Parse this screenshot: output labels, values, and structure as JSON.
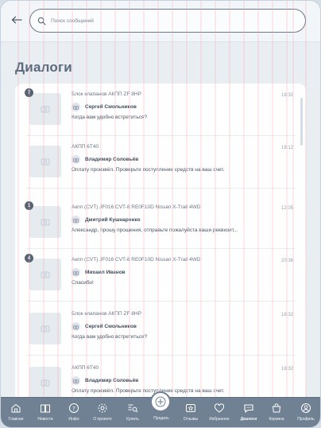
{
  "search": {
    "placeholder": "Поиск сообщений"
  },
  "page_title": "Диалоги",
  "dialogs": [
    {
      "badge": "7",
      "title": "Блок клапанов АКПП ZF 8HP",
      "user": "Сергей Смольников",
      "message": "Когда вам удобно встретиться?",
      "time": "18:32"
    },
    {
      "badge": "",
      "title": "АКПП 6T40",
      "user": "Владимир Соловьёв",
      "message": "Оплату произвёл. Проверьте поступление средств на ваш счет.",
      "time": "18:12"
    },
    {
      "badge": "1",
      "title": "Акпп (CVT) JF016 CVT-8 RE0F10D Nissan X-Trail 4WD",
      "user": "Дмитрий Кушнаренко",
      "message": "Александр, прошу прощения, отправьте пожалуйста ваши реквизит...",
      "time": "12:05"
    },
    {
      "badge": "4",
      "title": "Акпп (CVT) JF016 CVT-8 RE0F10D Nissan X-Trail 4WD",
      "user": "Михаил Иванов",
      "message": "Спасибо!",
      "time": "20:36"
    },
    {
      "badge": "",
      "title": "Блок клапанов АКПП ZF 8HP",
      "user": "Сергей Смольников",
      "message": "Когда вам удобно встретиться?",
      "time": "18:32"
    },
    {
      "badge": "",
      "title": "АКПП 6T40",
      "user": "Владимир Соловьёв",
      "message": "Оплату произвёл. Проверьте поступление средств на ваш счет.",
      "time": "18:32"
    }
  ],
  "bottom_nav": {
    "home": "Главная",
    "news": "Новости",
    "info": "Инфо",
    "about": "О проекте",
    "buy": "Купить",
    "sell": "Продать",
    "reviews": "Отзывы",
    "favorites": "Избранное",
    "dialogs": "Диалоги",
    "cart": "Корзина",
    "profile": "Профиль"
  }
}
